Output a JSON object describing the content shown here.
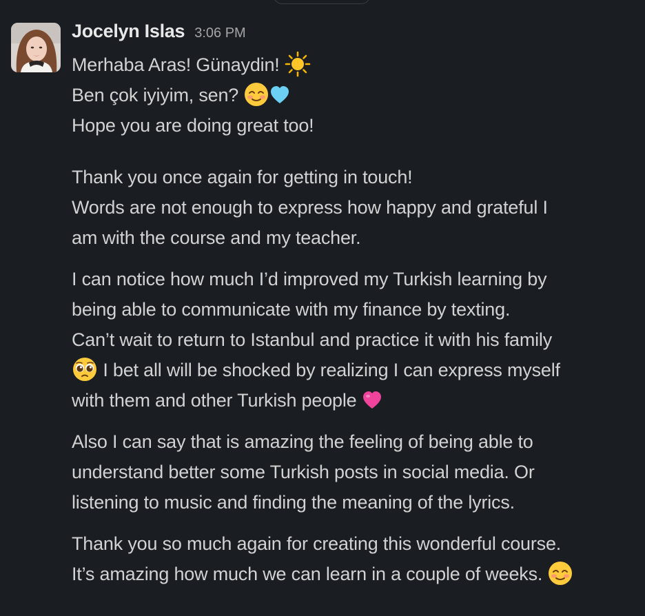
{
  "message": {
    "sender": "Jocelyn Islas",
    "time": "3:06 PM",
    "lines": {
      "l1": "Merhaba Aras! Günaydin!",
      "l2": "Ben çok iyiyim, sen?",
      "l3": "Hope you are doing great too!",
      "p2_1": "Thank you once again for getting in touch!",
      "p2_2": "Words are not enough to express how happy and grateful I",
      "p2_3": "am with the course and my teacher.",
      "p3_1": "I can notice how much I’d improved my Turkish learning by",
      "p3_2": "being able to communicate with my finance by texting.",
      "p3_3": "Can’t wait to return to Istanbul and practice it with his family",
      "p3_4": "I bet all will be shocked by realizing I can express myself",
      "p3_5": "with them and other Turkish people",
      "p4_1": "Also I can say that is amazing the feeling of being able to",
      "p4_2": "understand better some Turkish posts in social media. Or",
      "p4_3": "listening to music and finding the meaning of the lyrics.",
      "p5_1": "Thank you so much again for creating this wonderful course.",
      "p5_2": "It’s amazing how much we can learn in a couple of weeks."
    },
    "emojis": [
      "sun-emoji",
      "smiling-blush-emoji",
      "light-blue-heart-emoji",
      "pleading-face-emoji",
      "pink-heart-emoji",
      "smiling-blush-emoji"
    ]
  },
  "colors": {
    "background": "#1a1d21",
    "text": "#d1d2d3",
    "sender": "#e8e8e8",
    "timestamp": "#a4a5a7"
  }
}
